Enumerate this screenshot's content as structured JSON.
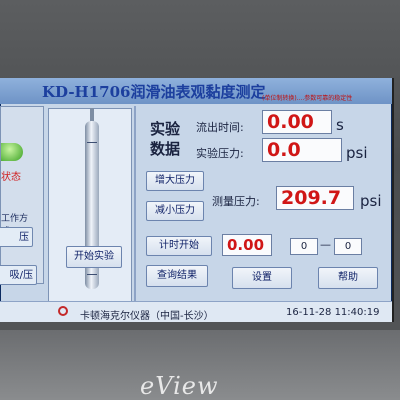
{
  "app": {
    "title": "KD-H1706润滑油表观黏度测定",
    "note": "(单位制转换)....参数可靠的稳定性"
  },
  "left": {
    "status_label": "状态",
    "mode_label": "工作方式：",
    "mode_button_1": "压",
    "mode_button_2": "吸/压"
  },
  "center": {
    "start_button": "开始实验"
  },
  "experiment": {
    "data_label_line1": "实验",
    "data_label_line2": "数据",
    "flow_time_label": "流出时间:",
    "flow_time_value": "0.00",
    "flow_time_unit": "s",
    "pressure_label": "实验压力:",
    "pressure_value": "0.0",
    "pressure_unit": "psi"
  },
  "pressure_control": {
    "increase_button": "增大压力",
    "decrease_button": "减小压力",
    "measure_label": "测量压力:",
    "measure_value": "209.7",
    "measure_unit": "psi"
  },
  "timer": {
    "start_button": "计时开始",
    "value": "0.00",
    "range_from": "0",
    "range_separator": "—",
    "range_to": "0"
  },
  "actions": {
    "query_button": "查询结果",
    "settings_button": "设置",
    "help_button": "帮助"
  },
  "footer": {
    "company": "卡顿海克尔仪器（中国-长沙）",
    "datetime": "16-11-28 11:40:19"
  },
  "device": {
    "brand": "eView"
  }
}
